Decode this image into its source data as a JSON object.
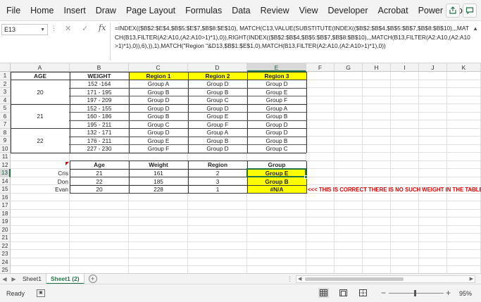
{
  "ribbon": {
    "tabs": [
      "File",
      "Home",
      "Insert",
      "Draw",
      "Page Layout",
      "Formulas",
      "Data",
      "Review",
      "View",
      "Developer",
      "Acrobat",
      "Power Pivot"
    ],
    "right_icons": [
      "share-icon",
      "comment-icon"
    ]
  },
  "formula_bar": {
    "name_box": "E13",
    "fx_label": "fx",
    "formula": "=INDEX(($B$2:$E$4,$B$5:$E$7,$B$8:$E$10), MATCH(C13,VALUE(SUBSTITUTE(INDEX(($B$2:$B$4,$B$5:$B$7,$B$8:$B$10),,,MATCH(B13,FILTER(A2:A10,(A2:A10>1)*1),0)),RIGHT(INDEX(($B$2:$B$4,$B$5:$B$7,$B$8:$B$10),,,MATCH(B13,FILTER(A2:A10,(A2:A10>1)*1),0)),6),)),1),MATCH(\"Region \"&D13,$B$1:$E$1,0),MATCH(B13,FILTER(A2:A10,(A2:A10>1)*1),0))"
  },
  "columns": [
    "A",
    "B",
    "C",
    "D",
    "E",
    "F",
    "G",
    "H",
    "I",
    "J",
    "K"
  ],
  "rows": [
    "1",
    "2",
    "3",
    "4",
    "5",
    "6",
    "7",
    "8",
    "9",
    "10",
    "11",
    "12",
    "13",
    "14",
    "15",
    "16",
    "17",
    "18",
    "19",
    "20",
    "21",
    "22",
    "23",
    "24",
    "25"
  ],
  "table1": {
    "headers": [
      "AGE",
      "WEIGHT",
      "Region 1",
      "Region 2",
      "Region 3"
    ],
    "ages": [
      "20",
      "21",
      "22"
    ],
    "rows": [
      [
        "152 -164",
        "Group A",
        "Group D",
        "Group D"
      ],
      [
        "171 - 195",
        "Group B",
        "Group B",
        "Group E"
      ],
      [
        "197 - 209",
        "Group D",
        "Group C",
        "Group F"
      ],
      [
        "152 - 155",
        "Group D",
        "Group D",
        "Group A"
      ],
      [
        "160 - 186",
        "Group B",
        "Group E",
        "Group B"
      ],
      [
        "195 - 211",
        "Group C",
        "Group F",
        "Group D"
      ],
      [
        "132 - 171",
        "Group D",
        "Group A",
        "Group D"
      ],
      [
        "176 - 211",
        "Group E",
        "Group B",
        "Group B"
      ],
      [
        "227 - 230",
        "Group F",
        "Group D",
        "Group C"
      ]
    ]
  },
  "table2": {
    "headers": [
      "Age",
      "Weight",
      "Region",
      "Group"
    ],
    "rows": [
      {
        "name": "Cris",
        "age": "21",
        "weight": "161",
        "region": "2",
        "group": "Group E"
      },
      {
        "name": "Don",
        "age": "22",
        "weight": "185",
        "region": "3",
        "group": "Group B"
      },
      {
        "name": "Evan",
        "age": "20",
        "weight": "228",
        "region": "1",
        "group": "#N/A"
      }
    ],
    "note": "<<< THIS IS CORRECT THERE IS NO SUCH WEIGHT IN THE TABLE"
  },
  "sheets": {
    "tabs": [
      "Sheet1",
      "Sheet1 (2)"
    ],
    "active": "Sheet1 (2)"
  },
  "status": {
    "ready": "Ready",
    "zoom": "95%"
  },
  "colors": {
    "accent": "#217346",
    "highlight": "#ffff00",
    "error_text": "#e00000"
  }
}
